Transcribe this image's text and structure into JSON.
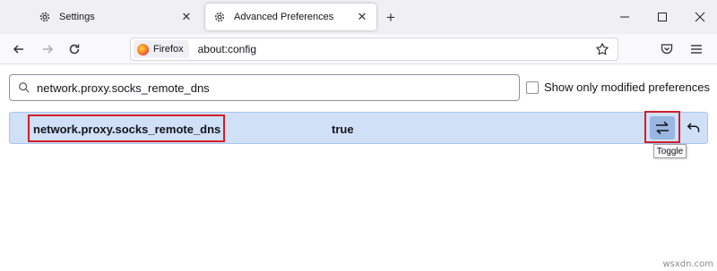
{
  "tabs": [
    {
      "label": "Settings",
      "icon": "gear-icon",
      "active": false
    },
    {
      "label": "Advanced Preferences",
      "icon": "gear-icon",
      "active": true
    }
  ],
  "window_controls": [
    "minimize-icon",
    "maximize-icon",
    "close-icon"
  ],
  "navbar": {
    "identity_label": "Firefox",
    "url": "about:config"
  },
  "search": {
    "value": "network.proxy.socks_remote_dns"
  },
  "show_modified_label": "Show only modified preferences",
  "preference": {
    "name": "network.proxy.socks_remote_dns",
    "value": "true"
  },
  "tooltip": "Toggle",
  "watermark": "wsxdn.com",
  "colors": {
    "row_highlight": "#cfe0f7",
    "annotation_red": "#d21f28",
    "toggle_button": "#9ab6e2"
  }
}
